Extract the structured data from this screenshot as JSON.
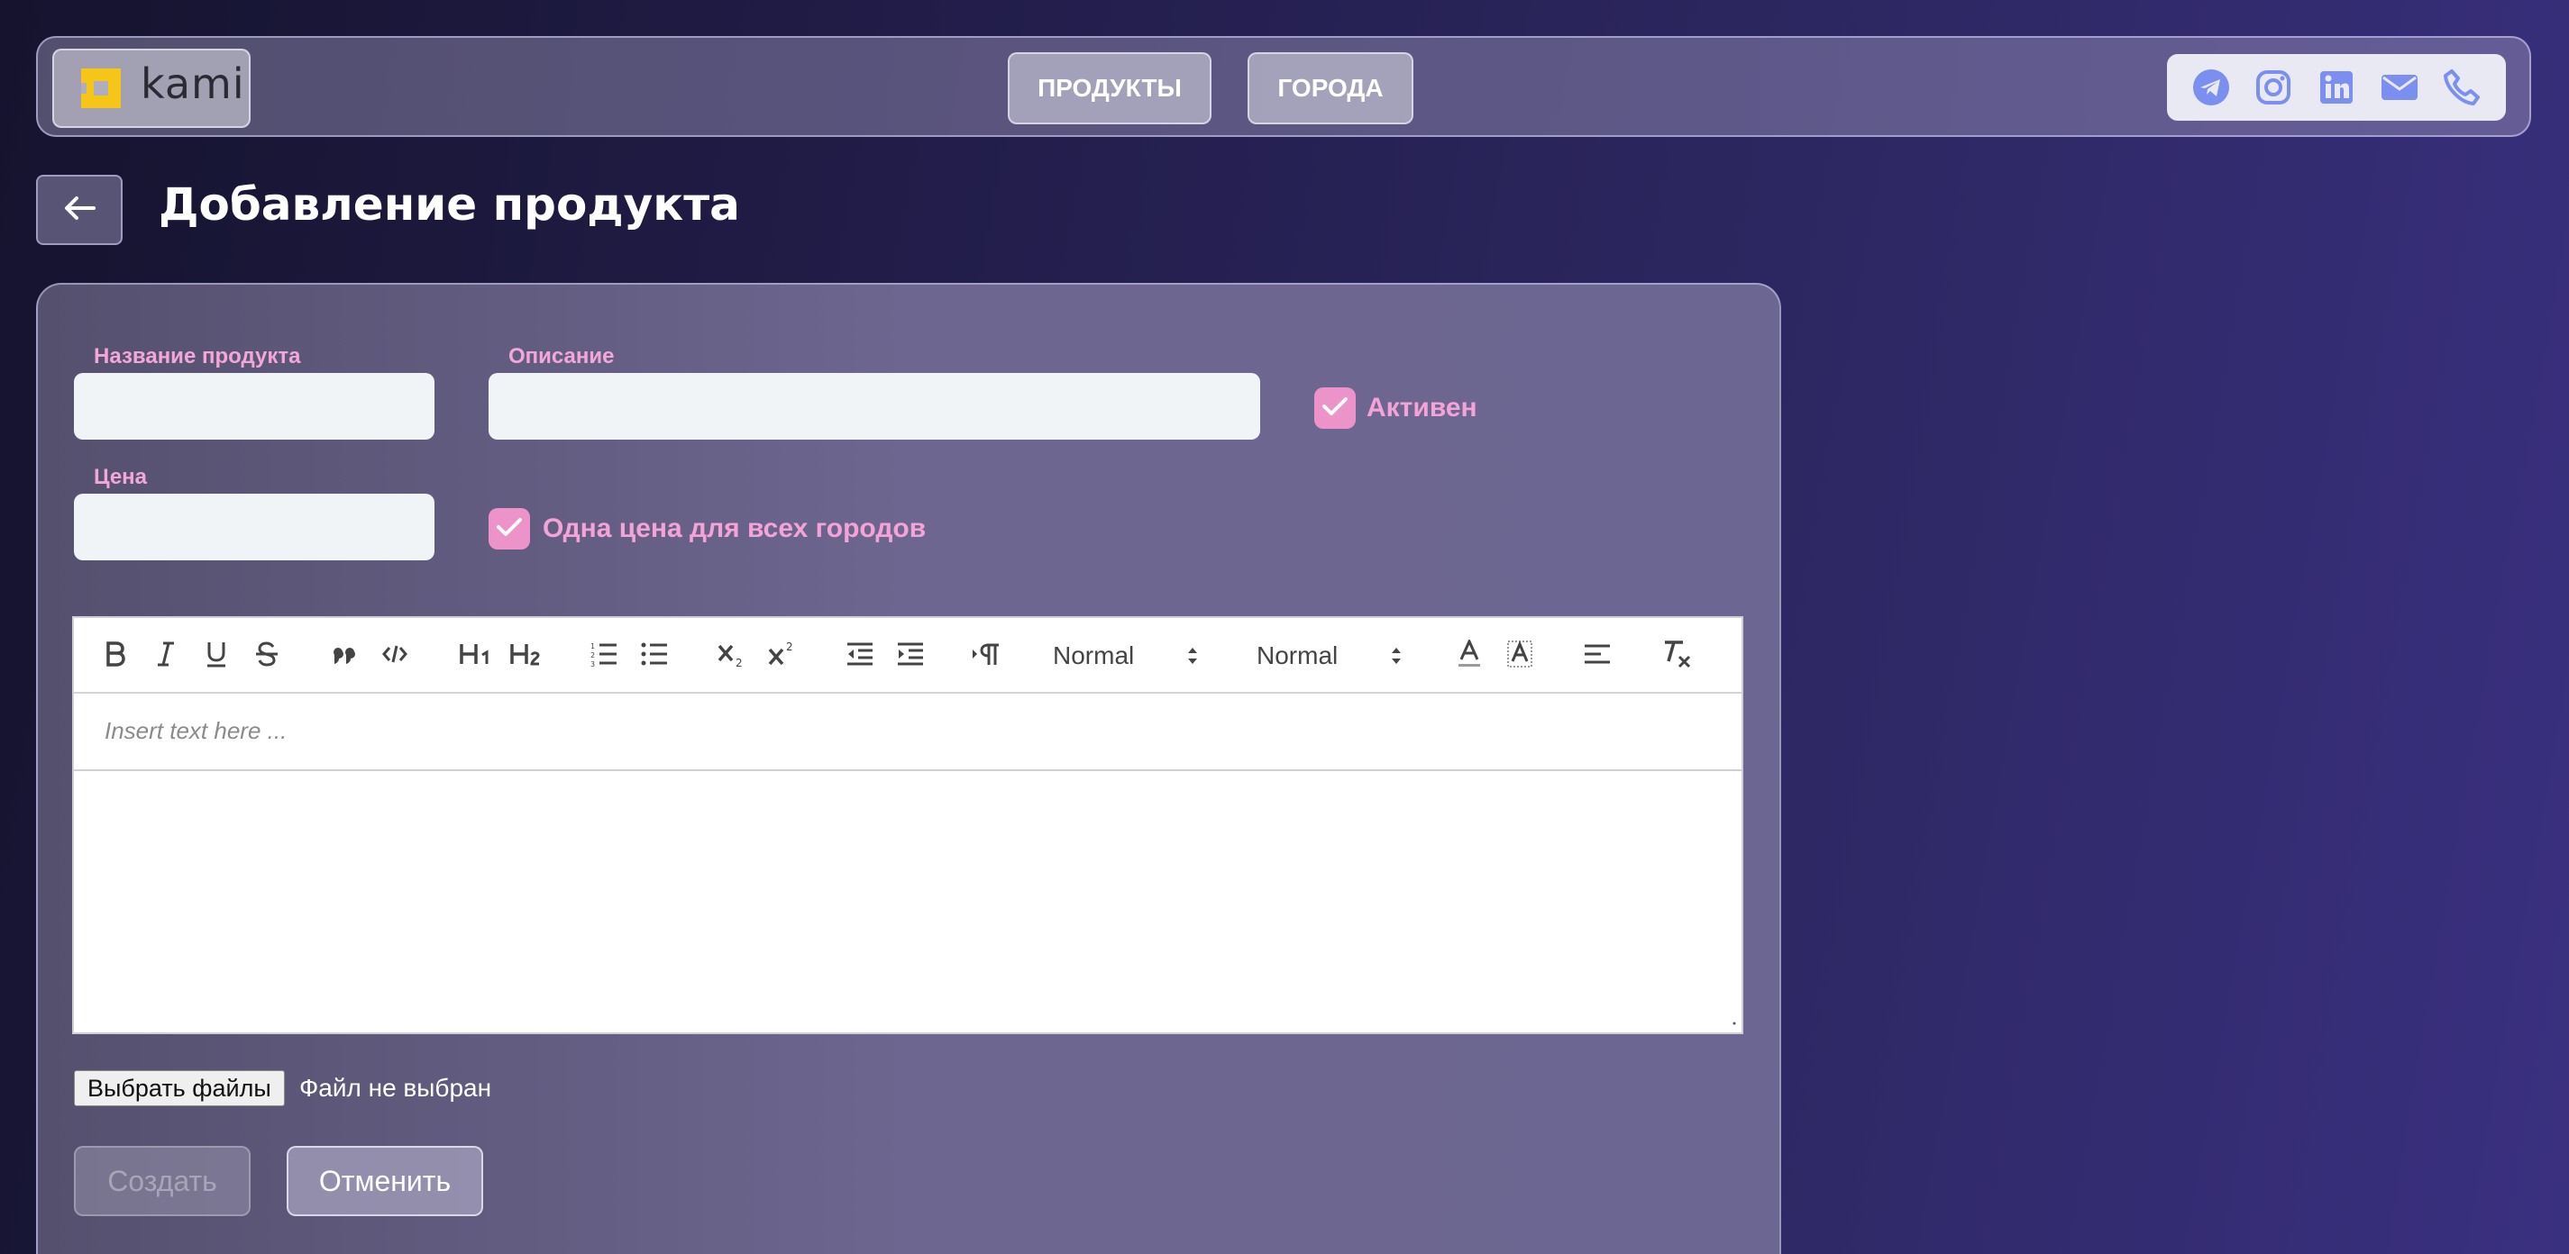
{
  "brand": {
    "name": "kami",
    "accent": "#f5c518"
  },
  "nav": {
    "products": "ПРОДУКТЫ",
    "cities": "ГОРОДА"
  },
  "social": [
    "telegram-icon",
    "instagram-icon",
    "linkedin-icon",
    "mail-icon",
    "phone-icon"
  ],
  "page": {
    "title": "Добавление продукта"
  },
  "form": {
    "name_label": "Название продукта",
    "name_value": "",
    "description_label": "Описание",
    "description_value": "",
    "active_label": "Активен",
    "active_checked": true,
    "price_label": "Цена",
    "price_value": "",
    "one_price_label": "Одна цена для всех городов",
    "one_price_checked": true
  },
  "editor": {
    "header_select": "Normal",
    "size_select": "Normal",
    "placeholder": "Insert text here ..."
  },
  "files": {
    "button_label": "Выбрать файлы",
    "status": "Файл не выбран"
  },
  "actions": {
    "create": "Создать",
    "cancel": "Отменить"
  },
  "colors": {
    "accent_pink": "#ec94c9",
    "label_pink": "#f2a7d8",
    "icon_blue": "#7a8ff0"
  }
}
